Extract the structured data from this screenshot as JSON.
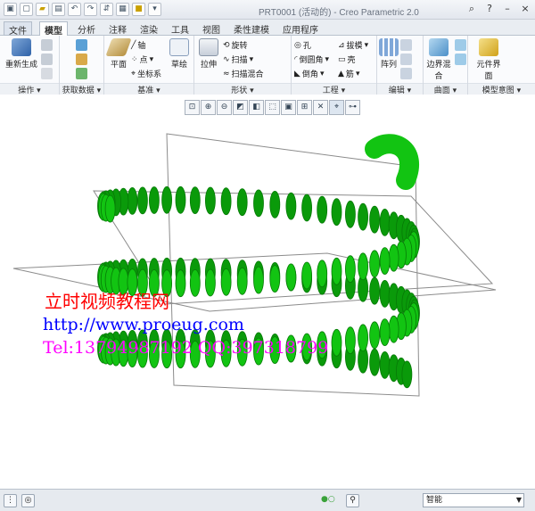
{
  "window": {
    "title": "PRT0001 (活动的) - Creo Parametric 2.0"
  },
  "tabs": [
    "文件",
    "模型",
    "分析",
    "注释",
    "渲染",
    "工具",
    "视图",
    "柔性建模",
    "应用程序"
  ],
  "ribbon": {
    "groups": {
      "operations": "操作",
      "get_data": "获取数据",
      "datum": "基准",
      "shapes": "形状",
      "engineering": "工程",
      "editing": "编辑",
      "surface": "曲面",
      "model_intent": "模型意图"
    },
    "regenerate": "重新生成",
    "plane": "平面",
    "axis": "轴",
    "point": "点",
    "csys": "坐标系",
    "sketch": "草绘",
    "extrude": "拉伸",
    "revolve": "旋转",
    "sweep": "扫描",
    "swept_blend": "扫描混合",
    "hole": "孔",
    "draft": "拔模",
    "round": "倒圆角",
    "shell": "壳",
    "chamfer": "倒角",
    "rib": "筋",
    "pattern": "阵列",
    "boundary_blend": "边界混合",
    "component_interface": "元件界面"
  },
  "watermark": {
    "line1": "立时视频教程网",
    "line2": "http://www.proeug.com",
    "line3": "Tel:13794987192  QQ:397318799"
  },
  "statusbar": {
    "filter_value": "智能"
  },
  "colors": {
    "model": "#12c412",
    "watermark_red": "#ff0000",
    "watermark_blue": "#0000ff",
    "watermark_magenta": "#ff00ff"
  }
}
